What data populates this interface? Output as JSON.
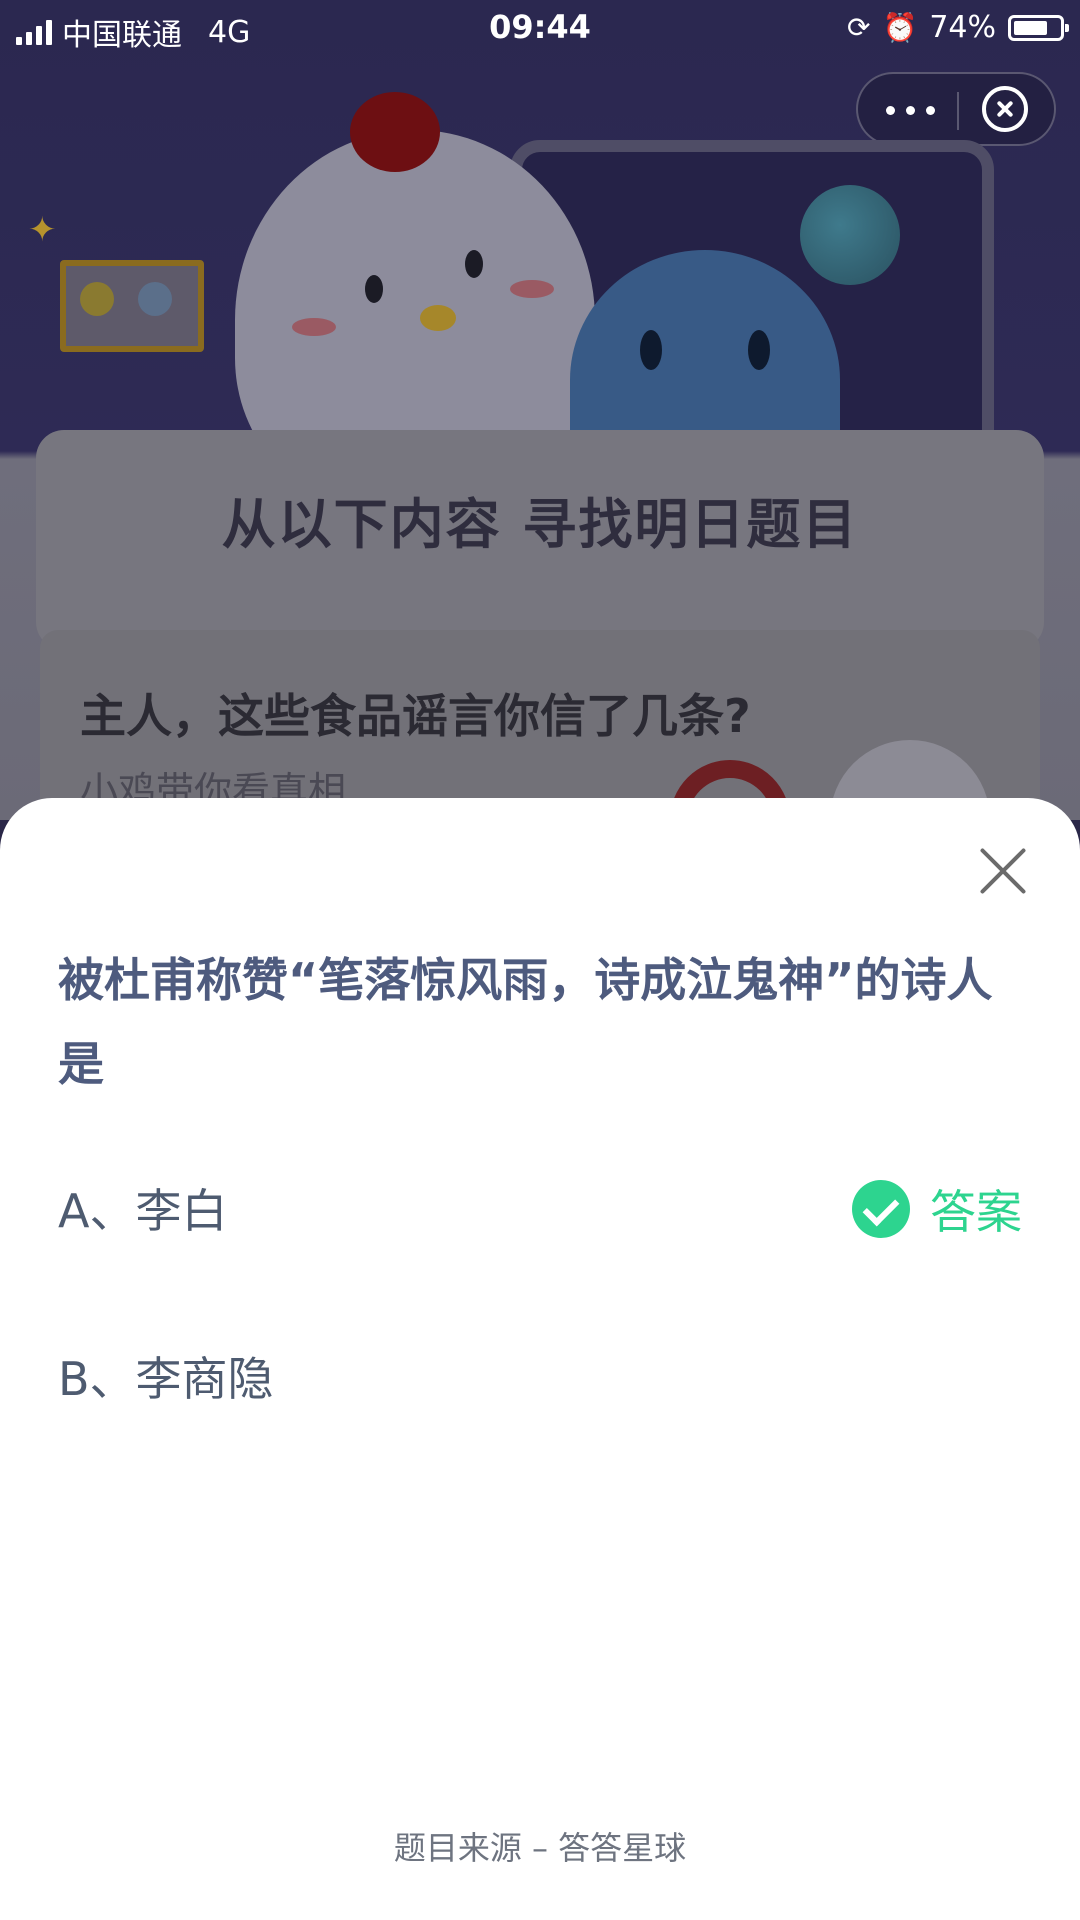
{
  "status_bar": {
    "carrier": "中国联通",
    "network": "4G",
    "time": "09:44",
    "battery_percent_text": "74%",
    "battery_level": 0.74
  },
  "capsule": {
    "more_icon": "more-dots-icon",
    "close_icon": "close-circle-icon"
  },
  "background": {
    "banner_title": "从以下内容  寻找明日题目",
    "article_title": "主人，这些食品谣言你信了几条?",
    "article_subtitle": "小鸡带你看真相"
  },
  "sheet": {
    "close_icon": "close-x-icon",
    "question": "被杜甫称赞“笔落惊风雨，诗成泣鬼神”的诗人是",
    "options": [
      {
        "label": "A、李白",
        "is_answer": true
      },
      {
        "label": "B、李商隐",
        "is_answer": false
      }
    ],
    "answer_label": "答案",
    "answer_color": "#2dd48f",
    "source": "题目来源 – 答答星球"
  }
}
